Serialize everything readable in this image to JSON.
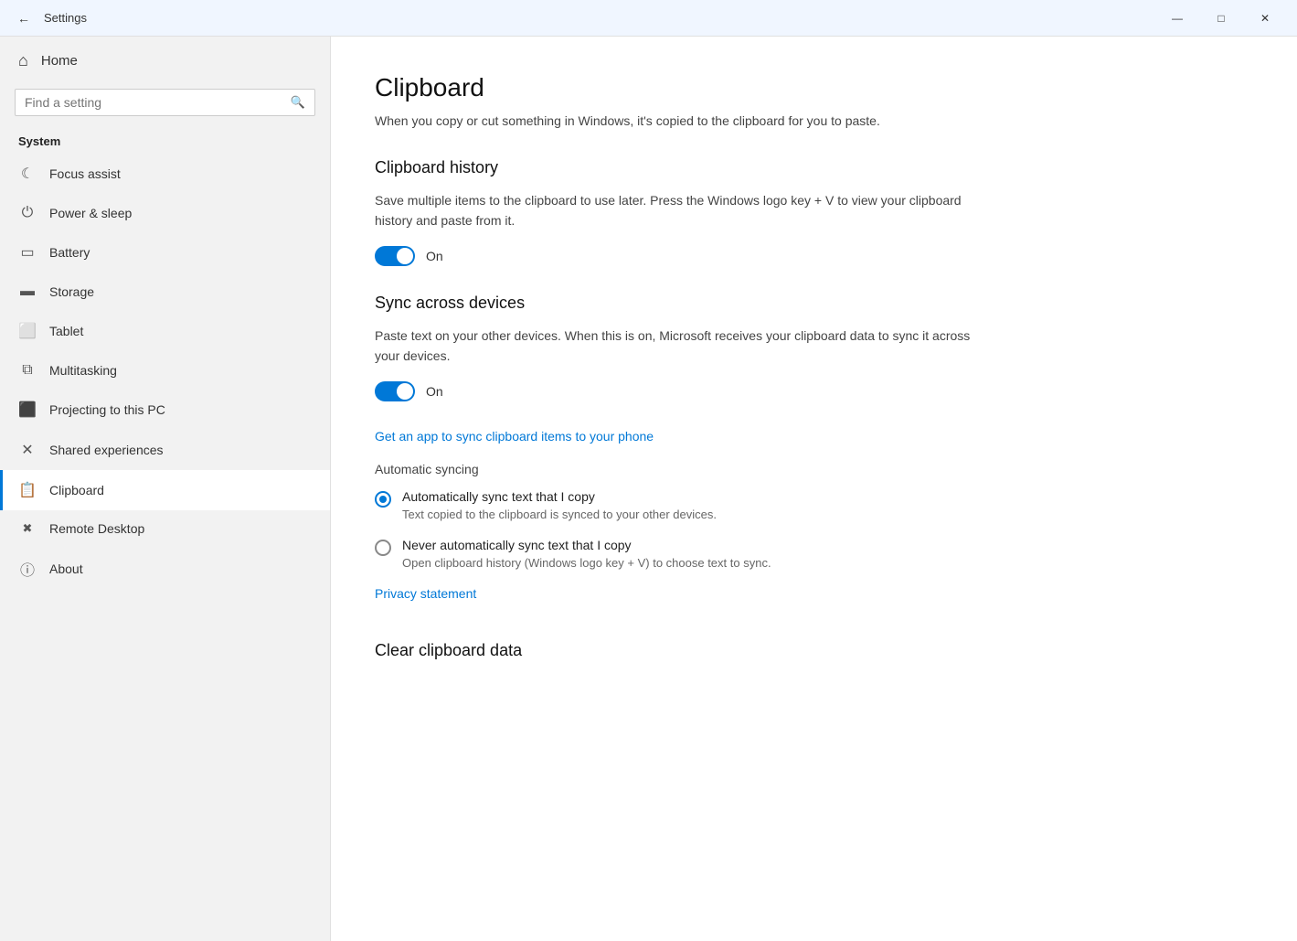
{
  "titleBar": {
    "title": "Settings",
    "backLabel": "←",
    "minimizeLabel": "—",
    "maximizeLabel": "□",
    "closeLabel": "✕"
  },
  "sidebar": {
    "homeLabel": "Home",
    "searchPlaceholder": "Find a setting",
    "sectionLabel": "System",
    "items": [
      {
        "id": "focus-assist",
        "label": "Focus assist",
        "icon": "☾"
      },
      {
        "id": "power-sleep",
        "label": "Power & sleep",
        "icon": "⏻"
      },
      {
        "id": "battery",
        "label": "Battery",
        "icon": "▭"
      },
      {
        "id": "storage",
        "label": "Storage",
        "icon": "▬"
      },
      {
        "id": "tablet",
        "label": "Tablet",
        "icon": "⬜"
      },
      {
        "id": "multitasking",
        "label": "Multitasking",
        "icon": "⧉"
      },
      {
        "id": "projecting",
        "label": "Projecting to this PC",
        "icon": "⬛"
      },
      {
        "id": "shared-experiences",
        "label": "Shared experiences",
        "icon": "✕"
      },
      {
        "id": "clipboard",
        "label": "Clipboard",
        "icon": "📋",
        "active": true
      },
      {
        "id": "remote-desktop",
        "label": "Remote Desktop",
        "icon": "✕"
      },
      {
        "id": "about",
        "label": "About",
        "icon": "ⓘ"
      }
    ]
  },
  "content": {
    "pageTitle": "Clipboard",
    "pageDescription": "When you copy or cut something in Windows, it's copied to the clipboard for you to paste.",
    "clipboardHistory": {
      "sectionTitle": "Clipboard history",
      "sectionDesc": "Save multiple items to the clipboard to use later. Press the Windows logo key + V to view your clipboard history and paste from it.",
      "toggleState": "on",
      "toggleLabel": "On"
    },
    "syncAcrossDevices": {
      "sectionTitle": "Sync across devices",
      "sectionDesc": "Paste text on your other devices. When this is on, Microsoft receives your clipboard data to sync it across your devices.",
      "toggleState": "on",
      "toggleLabel": "On",
      "linkLabel": "Get an app to sync clipboard items to your phone",
      "autoSyncLabel": "Automatic syncing",
      "radioOptions": [
        {
          "id": "auto-sync",
          "title": "Automatically sync text that I copy",
          "desc": "Text copied to the clipboard is synced to your other devices.",
          "selected": true
        },
        {
          "id": "never-sync",
          "title": "Never automatically sync text that I copy",
          "desc": "Open clipboard history (Windows logo key + V) to choose text to sync.",
          "selected": false
        }
      ],
      "privacyLink": "Privacy statement"
    },
    "clearClipboard": {
      "sectionTitle": "Clear clipboard data"
    }
  }
}
